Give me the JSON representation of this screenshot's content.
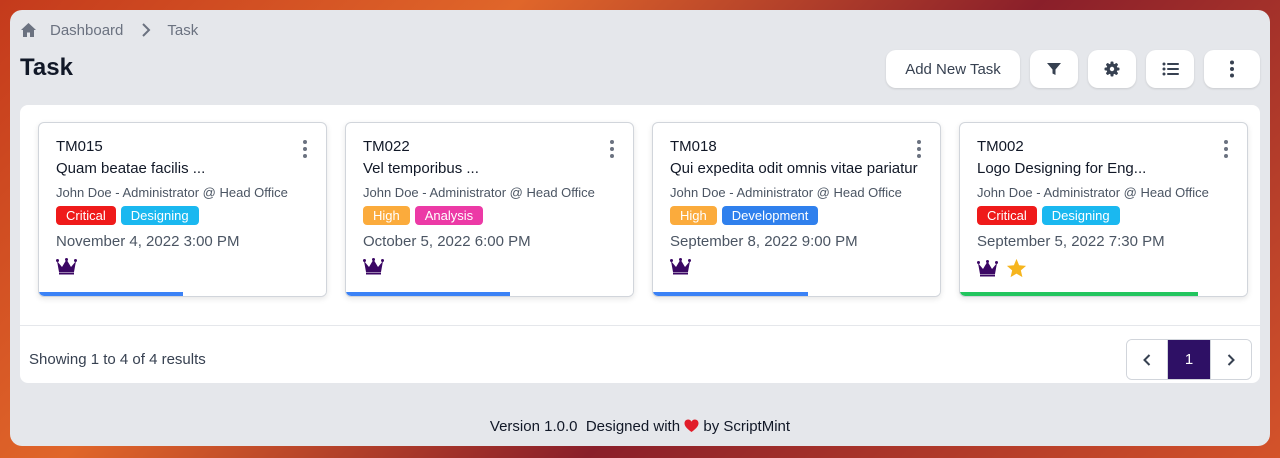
{
  "breadcrumb": {
    "home": "Dashboard",
    "current": "Task"
  },
  "page": {
    "title": "Task"
  },
  "toolbar": {
    "add_label": "Add New Task"
  },
  "tasks": [
    {
      "code": "TM015",
      "title": "Quam beatae facilis ...",
      "owner": "John Doe - Administrator @ Head Office",
      "priority": "Critical",
      "category": "Designing",
      "date": "November 4, 2022 3:00 PM",
      "progress": 0.5,
      "progress_color": "#3b82f6",
      "starred": false
    },
    {
      "code": "TM022",
      "title": "Vel temporibus ...",
      "owner": "John Doe - Administrator @ Head Office",
      "priority": "High",
      "category": "Analysis",
      "date": "October 5, 2022 6:00 PM",
      "progress": 0.57,
      "progress_color": "#3b82f6",
      "starred": false
    },
    {
      "code": "TM018",
      "title": "Qui expedita odit omnis vitae pariatur",
      "owner": "John Doe - Administrator @ Head Office",
      "priority": "High",
      "category": "Development",
      "date": "September 8, 2022 9:00 PM",
      "progress": 0.54,
      "progress_color": "#3b82f6",
      "starred": false
    },
    {
      "code": "TM002",
      "title": "Logo Designing for Eng...",
      "owner": "John Doe - Administrator @ Head Office",
      "priority": "Critical",
      "category": "Designing",
      "date": "September 5, 2022 7:30 PM",
      "progress": 0.83,
      "progress_color": "#22c55e",
      "starred": true
    }
  ],
  "tag_colors": {
    "Critical": "#ef1a1a",
    "High": "#fbab3c",
    "Designing": "#1ab8f0",
    "Analysis": "#ec3aa6",
    "Development": "#2f80ed"
  },
  "pagination": {
    "summary": "Showing 1 to 4 of 4 results",
    "current": "1"
  },
  "footer": {
    "version": "Version 1.0.0",
    "designed_with": "Designed with",
    "by": "by ScriptMint"
  },
  "colors": {
    "accent": "#2e1065",
    "crown": "#3b0764",
    "star": "#f6b51e"
  }
}
